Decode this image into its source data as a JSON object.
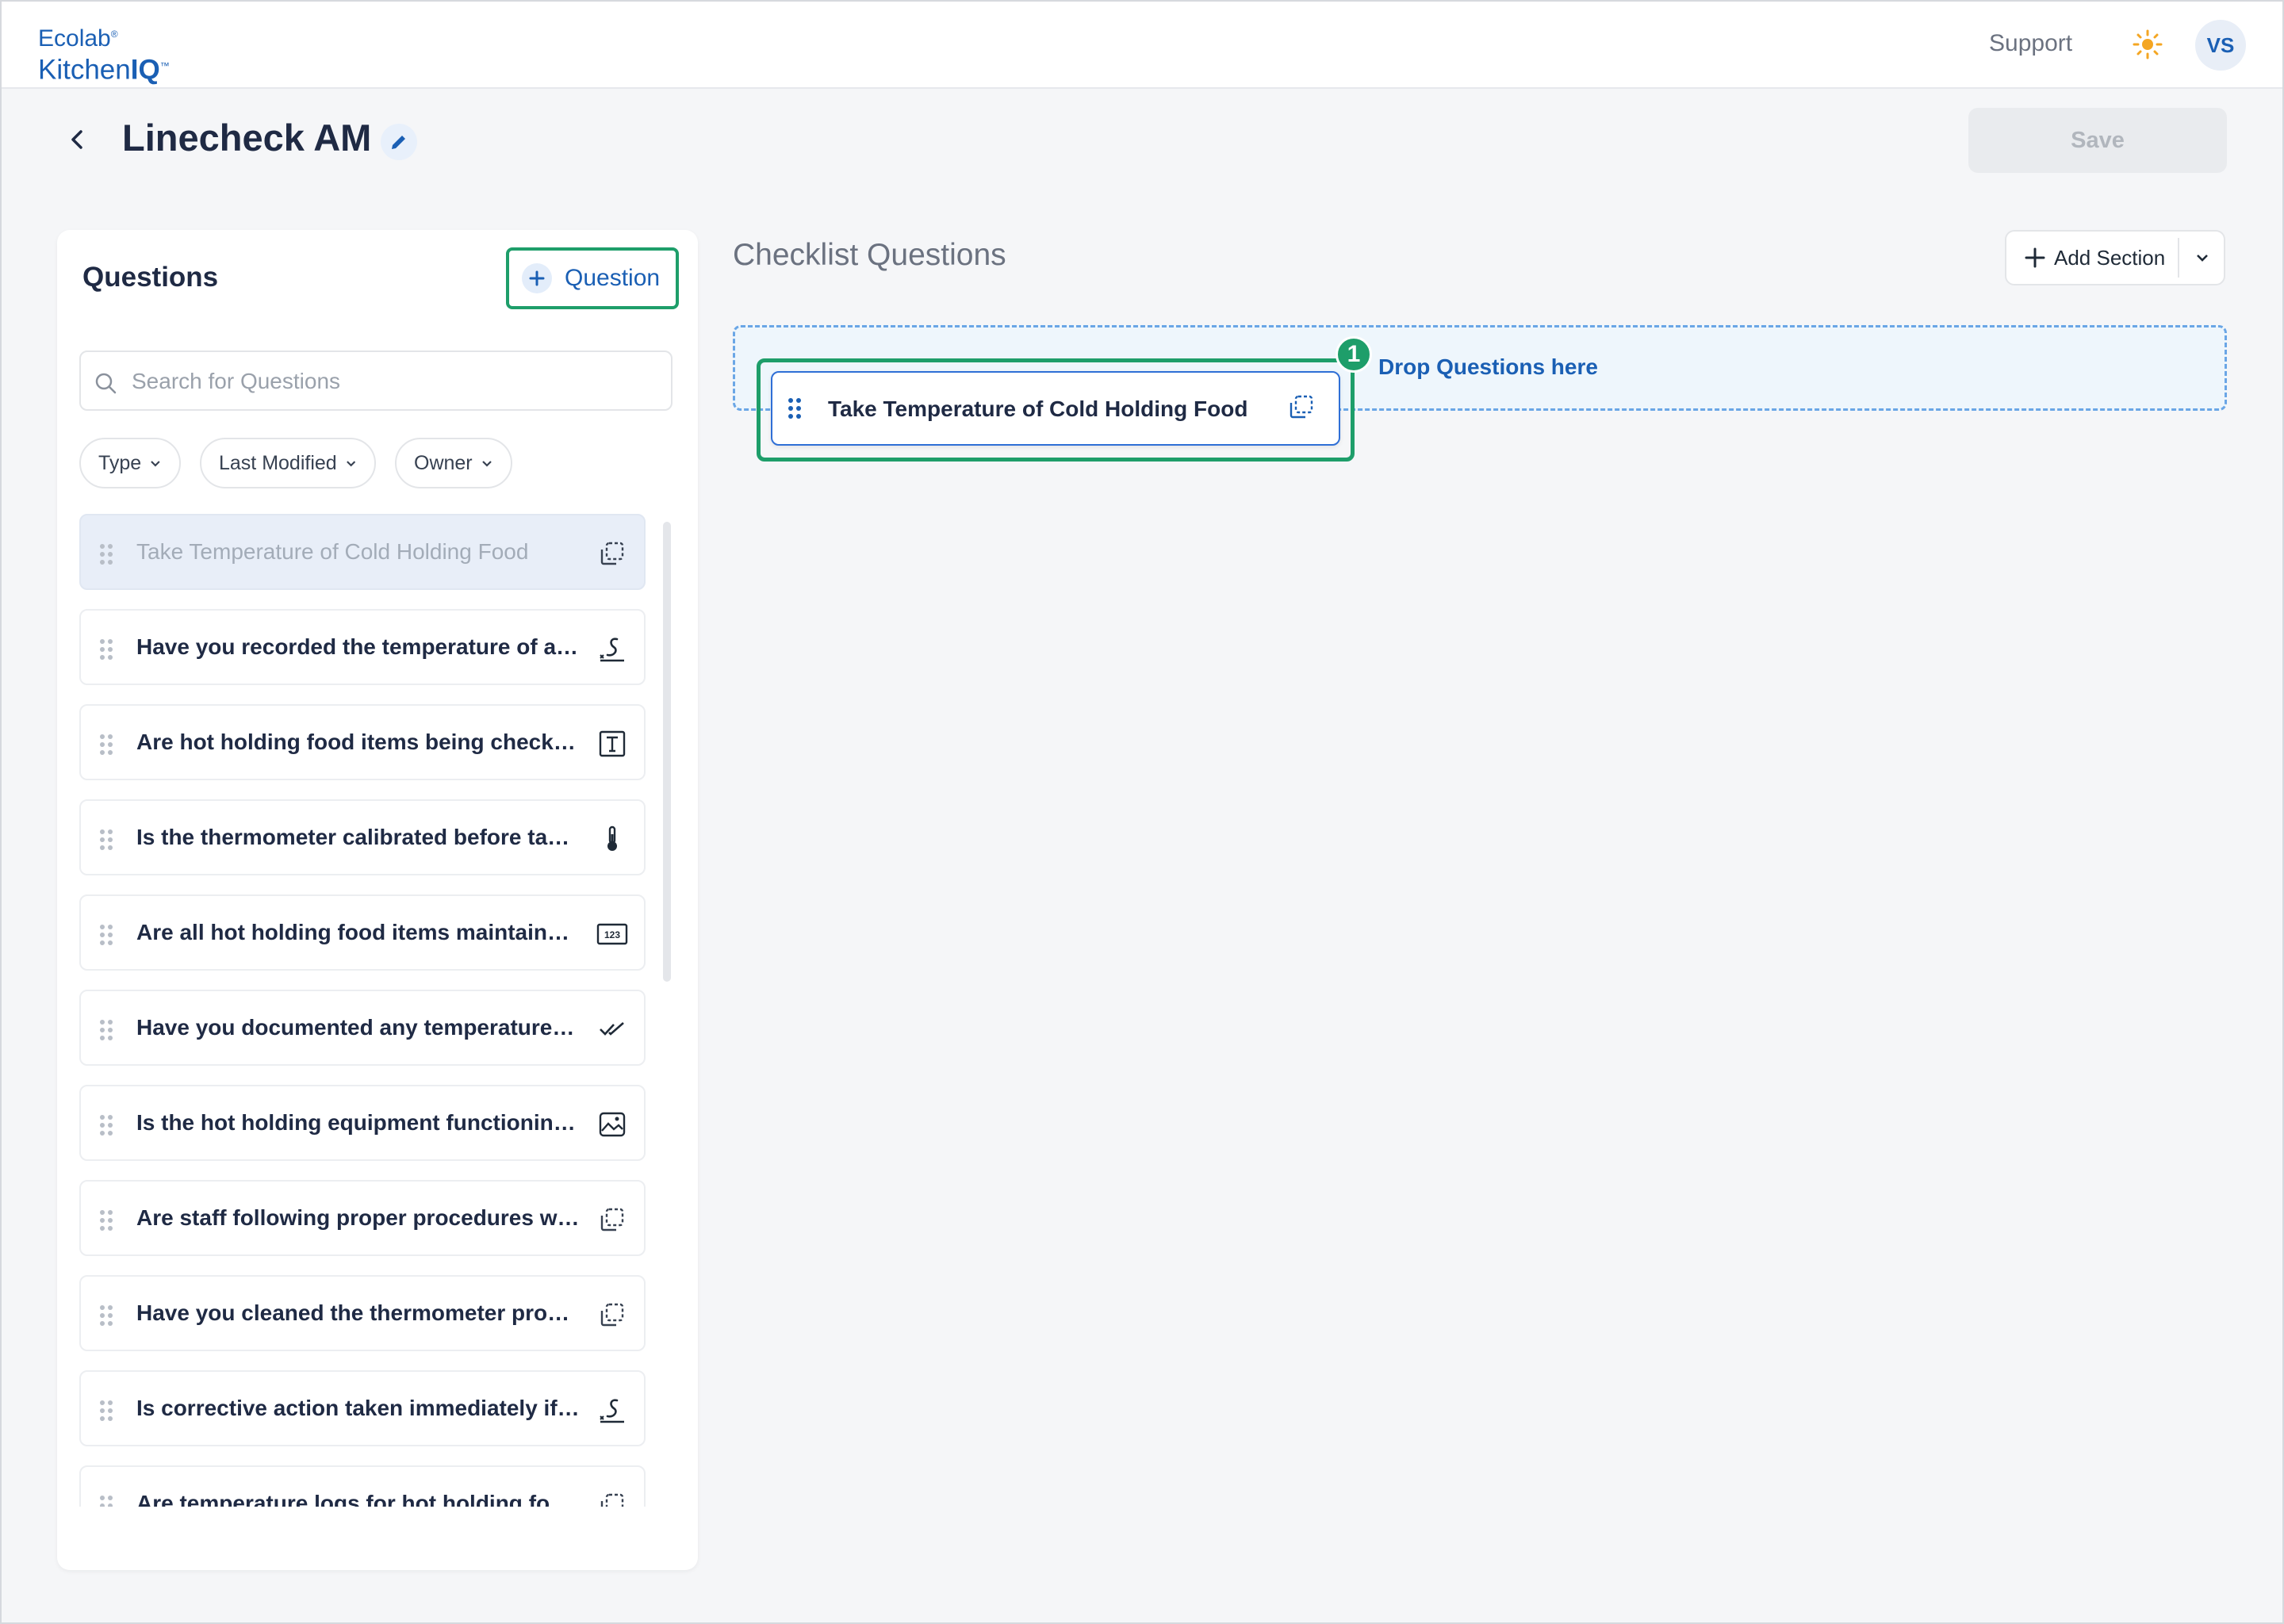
{
  "header": {
    "logo_line1": "Ecolab",
    "logo_kitchen": "Kitchen",
    "logo_iq": "IQ",
    "support_label": "Support",
    "theme_icon": "sun-icon",
    "avatar_initials": "VS"
  },
  "page": {
    "title": "Linecheck AM",
    "save_label": "Save"
  },
  "questions_panel": {
    "title": "Questions",
    "add_question_label": "Question",
    "search_placeholder": "Search for Questions",
    "filters": [
      "Type",
      "Last Modified",
      "Owner"
    ],
    "items": [
      {
        "text": "Take Temperature of Cold Holding Food",
        "icon": "copy-icon",
        "state": "dragging-source"
      },
      {
        "text": "Have you recorded the temperature of all hot holding food items?",
        "icon": "signature-icon"
      },
      {
        "text": "Are hot holding food items being checked regularly?",
        "icon": "text-icon"
      },
      {
        "text": "Is the thermometer calibrated before taking temperatures?",
        "icon": "thermometer-icon"
      },
      {
        "text": "Are all hot holding food items maintained at the proper temperature?",
        "icon": "number-icon"
      },
      {
        "text": "Have you documented any temperature deviations?",
        "icon": "double-check-icon"
      },
      {
        "text": "Is the hot holding equipment functioning properly?",
        "icon": "image-icon"
      },
      {
        "text": "Are staff following proper procedures when checking temperatures?",
        "icon": "copy-icon"
      },
      {
        "text": "Have you cleaned the thermometer probe between uses?",
        "icon": "copy-icon"
      },
      {
        "text": "Is corrective action taken immediately if hot holding food is out of range?",
        "icon": "signature-icon"
      },
      {
        "text": "Are temperature logs for hot holding food reviewed daily?",
        "icon": "copy-icon"
      }
    ]
  },
  "checklist": {
    "title": "Checklist Questions",
    "add_section_label": "Add Section",
    "dropzone_label": "Drop Questions here",
    "dragged_item": {
      "text": "Take Temperature of Cold Holding Food",
      "icon": "copy-icon"
    },
    "step_badge": "1"
  },
  "colors": {
    "brand_blue": "#1a5fb4",
    "highlight_green": "#1e9e6a",
    "dropzone_border": "#6aa6e6"
  }
}
